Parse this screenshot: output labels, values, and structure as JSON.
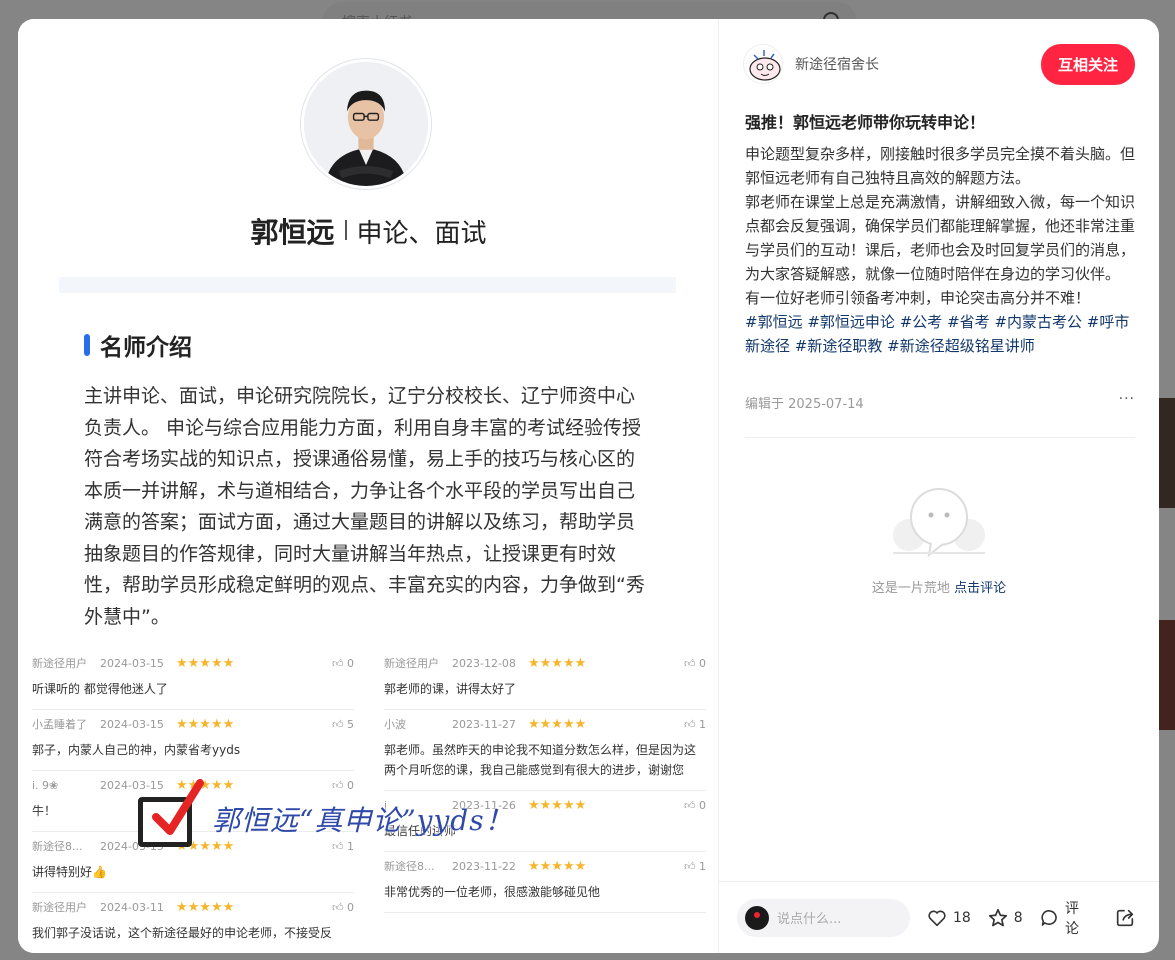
{
  "background": {
    "search_placeholder": "搜索小红书"
  },
  "poster": {
    "teacher_name": "郭恒远",
    "teacher_subjects": "申论、面试",
    "intro_title": "名师介绍",
    "intro_text": "主讲申论、面试，申论研究院院长，辽宁分校校长、辽宁师资中心负责人。 申论与综合应用能力方面，利用自身丰富的考试经验传授符合考场实战的知识点，授课通俗易懂，易上手的技巧与核心区的本质一并讲解，术与道相结合，力争让各个水平段的学员写出自己满意的答案；面试方面，通过大量题目的讲解以及练习，帮助学员抽象题目的作答规律，同时大量讲解当年热点，让授课更有时效性，帮助学员形成稳定鲜明的观点、丰富充实的内容，力争做到“秀外慧中”。",
    "stamp_text": "郭恒远“真申论”yyds！",
    "reviews_left": [
      {
        "user": "新途径用户",
        "date": "2024-03-15",
        "stars": "★★★★★",
        "likes": "0",
        "text": "听课听的 都觉得他迷人了"
      },
      {
        "user": "小孟睡着了",
        "date": "2024-03-15",
        "stars": "★★★★★",
        "likes": "5",
        "text": "郭子，内蒙人自己的神，内蒙省考yyds"
      },
      {
        "user": "i. 9❀",
        "date": "2024-03-15",
        "stars": "★★★★★",
        "likes": "0",
        "text": "牛！"
      },
      {
        "user": "新途径8...",
        "date": "2024-03-15",
        "stars": "★★★★★",
        "likes": "1",
        "text": "讲得特别好👍"
      },
      {
        "user": "新途径用户",
        "date": "2024-03-11",
        "stars": "★★★★★",
        "likes": "0",
        "text": "我们郭子没话说，这个新途径最好的申论老师，不接受反"
      }
    ],
    "reviews_right": [
      {
        "user": "新途径用户",
        "date": "2023-12-08",
        "stars": "★★★★★",
        "likes": "0",
        "text": "郭老师的课，讲得太好了"
      },
      {
        "user": "小波",
        "date": "2023-11-27",
        "stars": "★★★★★",
        "likes": "1",
        "text": "郭老师。虽然昨天的申论我不知道分数怎么样，但是因为这两个月听您的课，我自己能感觉到有很大的进步，谢谢您"
      },
      {
        "user": "j",
        "date": "2023-11-26",
        "stars": "★★★★★",
        "likes": "0",
        "text": "最信任的讲师"
      },
      {
        "user": "新途径8...",
        "date": "2023-11-22",
        "stars": "★★★★★",
        "likes": "1",
        "text": "非常优秀的一位老师，很感激能够碰见他"
      }
    ]
  },
  "author": {
    "name": "新途径宿舍长",
    "follow_label": "互相关注"
  },
  "post": {
    "title": "强推！郭恒远老师带你玩转申论！",
    "paragraphs": [
      "申论题型复杂多样，刚接触时很多学员完全摸不着头脑。但郭恒远老师有自己独特且高效的解题方法。",
      "郭老师在课堂上总是充满激情，讲解细致入微，每一个知识点都会反复强调，确保学员们都能理解掌握，他还非常注重与学员们的互动！课后，老师也会及时回复学员们的消息，为大家答疑解惑，就像一位随时陪伴在身边的学习伙伴。",
      "有一位好老师引领备考冲刺，申论突击高分并不难！"
    ],
    "tags": [
      "#郭恒远",
      "#郭恒远申论",
      "#公考",
      "#省考",
      "#内蒙古考公",
      "#呼市新途径",
      "#新途径职教",
      "#新途径超级铭星讲师"
    ],
    "edit_date": "编辑于 2025-07-14",
    "more": "···"
  },
  "comments": {
    "empty_text": "这是一片荒地",
    "empty_link": "点击评论"
  },
  "bottom": {
    "input_placeholder": "说点什么...",
    "likes": "18",
    "collects": "8",
    "comment_label": "评论"
  },
  "colors": {
    "accent": "#ff2442",
    "tag": "#13386c",
    "star": "#f6b52b",
    "intro_bar": "#2b6de6"
  }
}
